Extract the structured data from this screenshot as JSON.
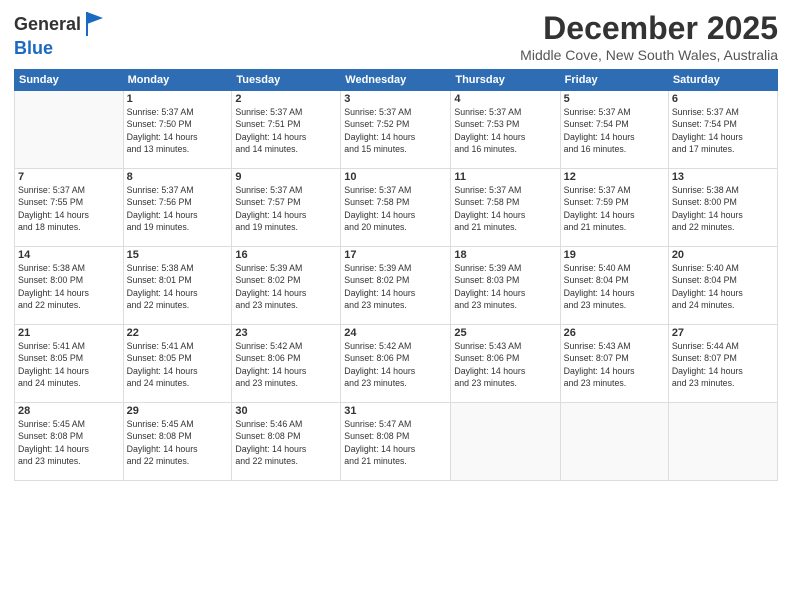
{
  "header": {
    "logo_line1": "General",
    "logo_line2": "Blue",
    "month_title": "December 2025",
    "location": "Middle Cove, New South Wales, Australia"
  },
  "days_of_week": [
    "Sunday",
    "Monday",
    "Tuesday",
    "Wednesday",
    "Thursday",
    "Friday",
    "Saturday"
  ],
  "weeks": [
    [
      {
        "day": "",
        "info": ""
      },
      {
        "day": "1",
        "info": "Sunrise: 5:37 AM\nSunset: 7:50 PM\nDaylight: 14 hours\nand 13 minutes."
      },
      {
        "day": "2",
        "info": "Sunrise: 5:37 AM\nSunset: 7:51 PM\nDaylight: 14 hours\nand 14 minutes."
      },
      {
        "day": "3",
        "info": "Sunrise: 5:37 AM\nSunset: 7:52 PM\nDaylight: 14 hours\nand 15 minutes."
      },
      {
        "day": "4",
        "info": "Sunrise: 5:37 AM\nSunset: 7:53 PM\nDaylight: 14 hours\nand 16 minutes."
      },
      {
        "day": "5",
        "info": "Sunrise: 5:37 AM\nSunset: 7:54 PM\nDaylight: 14 hours\nand 16 minutes."
      },
      {
        "day": "6",
        "info": "Sunrise: 5:37 AM\nSunset: 7:54 PM\nDaylight: 14 hours\nand 17 minutes."
      }
    ],
    [
      {
        "day": "7",
        "info": "Sunrise: 5:37 AM\nSunset: 7:55 PM\nDaylight: 14 hours\nand 18 minutes."
      },
      {
        "day": "8",
        "info": "Sunrise: 5:37 AM\nSunset: 7:56 PM\nDaylight: 14 hours\nand 19 minutes."
      },
      {
        "day": "9",
        "info": "Sunrise: 5:37 AM\nSunset: 7:57 PM\nDaylight: 14 hours\nand 19 minutes."
      },
      {
        "day": "10",
        "info": "Sunrise: 5:37 AM\nSunset: 7:58 PM\nDaylight: 14 hours\nand 20 minutes."
      },
      {
        "day": "11",
        "info": "Sunrise: 5:37 AM\nSunset: 7:58 PM\nDaylight: 14 hours\nand 21 minutes."
      },
      {
        "day": "12",
        "info": "Sunrise: 5:37 AM\nSunset: 7:59 PM\nDaylight: 14 hours\nand 21 minutes."
      },
      {
        "day": "13",
        "info": "Sunrise: 5:38 AM\nSunset: 8:00 PM\nDaylight: 14 hours\nand 22 minutes."
      }
    ],
    [
      {
        "day": "14",
        "info": "Sunrise: 5:38 AM\nSunset: 8:00 PM\nDaylight: 14 hours\nand 22 minutes."
      },
      {
        "day": "15",
        "info": "Sunrise: 5:38 AM\nSunset: 8:01 PM\nDaylight: 14 hours\nand 22 minutes."
      },
      {
        "day": "16",
        "info": "Sunrise: 5:39 AM\nSunset: 8:02 PM\nDaylight: 14 hours\nand 23 minutes."
      },
      {
        "day": "17",
        "info": "Sunrise: 5:39 AM\nSunset: 8:02 PM\nDaylight: 14 hours\nand 23 minutes."
      },
      {
        "day": "18",
        "info": "Sunrise: 5:39 AM\nSunset: 8:03 PM\nDaylight: 14 hours\nand 23 minutes."
      },
      {
        "day": "19",
        "info": "Sunrise: 5:40 AM\nSunset: 8:04 PM\nDaylight: 14 hours\nand 23 minutes."
      },
      {
        "day": "20",
        "info": "Sunrise: 5:40 AM\nSunset: 8:04 PM\nDaylight: 14 hours\nand 24 minutes."
      }
    ],
    [
      {
        "day": "21",
        "info": "Sunrise: 5:41 AM\nSunset: 8:05 PM\nDaylight: 14 hours\nand 24 minutes."
      },
      {
        "day": "22",
        "info": "Sunrise: 5:41 AM\nSunset: 8:05 PM\nDaylight: 14 hours\nand 24 minutes."
      },
      {
        "day": "23",
        "info": "Sunrise: 5:42 AM\nSunset: 8:06 PM\nDaylight: 14 hours\nand 23 minutes."
      },
      {
        "day": "24",
        "info": "Sunrise: 5:42 AM\nSunset: 8:06 PM\nDaylight: 14 hours\nand 23 minutes."
      },
      {
        "day": "25",
        "info": "Sunrise: 5:43 AM\nSunset: 8:06 PM\nDaylight: 14 hours\nand 23 minutes."
      },
      {
        "day": "26",
        "info": "Sunrise: 5:43 AM\nSunset: 8:07 PM\nDaylight: 14 hours\nand 23 minutes."
      },
      {
        "day": "27",
        "info": "Sunrise: 5:44 AM\nSunset: 8:07 PM\nDaylight: 14 hours\nand 23 minutes."
      }
    ],
    [
      {
        "day": "28",
        "info": "Sunrise: 5:45 AM\nSunset: 8:08 PM\nDaylight: 14 hours\nand 23 minutes."
      },
      {
        "day": "29",
        "info": "Sunrise: 5:45 AM\nSunset: 8:08 PM\nDaylight: 14 hours\nand 22 minutes."
      },
      {
        "day": "30",
        "info": "Sunrise: 5:46 AM\nSunset: 8:08 PM\nDaylight: 14 hours\nand 22 minutes."
      },
      {
        "day": "31",
        "info": "Sunrise: 5:47 AM\nSunset: 8:08 PM\nDaylight: 14 hours\nand 21 minutes."
      },
      {
        "day": "",
        "info": ""
      },
      {
        "day": "",
        "info": ""
      },
      {
        "day": "",
        "info": ""
      }
    ]
  ]
}
